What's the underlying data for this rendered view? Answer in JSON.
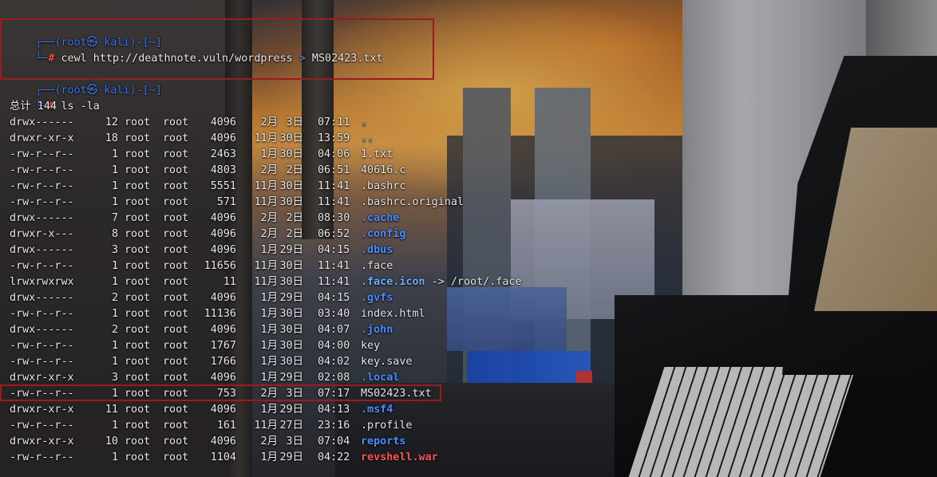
{
  "theme": {
    "prompt_color": "#3f74e8",
    "root_color": "#ff4a4a",
    "dir_color": "#4a8cff",
    "highlight_border": "#9b1b22"
  },
  "session": {
    "prompt1_top": "┌──(root㉿ kali)-[~]",
    "prompt1_mark": "└─",
    "prompt1_hash": "#",
    "cmd1": "cewl http://deathnote.vuln/wordpress",
    "cmd1_redirect": " > ",
    "cmd1_target": "MS02423.txt",
    "prompt2_top": "┌──(root㉿ kali)-[~]",
    "prompt2_mark": "└─",
    "prompt2_hash": "#",
    "cmd2": "ls -la",
    "total": "总计 144"
  },
  "listing": [
    {
      "perm": "drwx------",
      "links": "12",
      "user": "root",
      "group": "root",
      "size": "4096",
      "mon": "2月",
      "day": "3日",
      "time": "07:11",
      "name": ".",
      "kind": "dir"
    },
    {
      "perm": "drwxr-xr-x",
      "links": "18",
      "user": "root",
      "group": "root",
      "size": "4096",
      "mon": "11月",
      "day": "30日",
      "time": "13:59",
      "name": "..",
      "kind": "dir"
    },
    {
      "perm": "-rw-r--r--",
      "links": "1",
      "user": "root",
      "group": "root",
      "size": "2463",
      "mon": "1月",
      "day": "30日",
      "time": "04:06",
      "name": "1.txt",
      "kind": "plain"
    },
    {
      "perm": "-rw-r--r--",
      "links": "1",
      "user": "root",
      "group": "root",
      "size": "4803",
      "mon": "2月",
      "day": "2日",
      "time": "06:51",
      "name": "40616.c",
      "kind": "plain"
    },
    {
      "perm": "-rw-r--r--",
      "links": "1",
      "user": "root",
      "group": "root",
      "size": "5551",
      "mon": "11月",
      "day": "30日",
      "time": "11:41",
      "name": ".bashrc",
      "kind": "plain"
    },
    {
      "perm": "-rw-r--r--",
      "links": "1",
      "user": "root",
      "group": "root",
      "size": "571",
      "mon": "11月",
      "day": "30日",
      "time": "11:41",
      "name": ".bashrc.original",
      "kind": "plain"
    },
    {
      "perm": "drwx------",
      "links": "7",
      "user": "root",
      "group": "root",
      "size": "4096",
      "mon": "2月",
      "day": "2日",
      "time": "08:30",
      "name": ".cache",
      "kind": "dir"
    },
    {
      "perm": "drwxr-x---",
      "links": "8",
      "user": "root",
      "group": "root",
      "size": "4096",
      "mon": "2月",
      "day": "2日",
      "time": "06:52",
      "name": ".config",
      "kind": "dir"
    },
    {
      "perm": "drwx------",
      "links": "3",
      "user": "root",
      "group": "root",
      "size": "4096",
      "mon": "1月",
      "day": "29日",
      "time": "04:15",
      "name": ".dbus",
      "kind": "dir"
    },
    {
      "perm": "-rw-r--r--",
      "links": "1",
      "user": "root",
      "group": "root",
      "size": "11656",
      "mon": "11月",
      "day": "30日",
      "time": "11:41",
      "name": ".face",
      "kind": "plain"
    },
    {
      "perm": "lrwxrwxrwx",
      "links": "1",
      "user": "root",
      "group": "root",
      "size": "11",
      "mon": "11月",
      "day": "30日",
      "time": "11:41",
      "name": ".face.icon",
      "link_arrow": " -> ",
      "link_target": "/root/.face",
      "kind": "link"
    },
    {
      "perm": "drwx------",
      "links": "2",
      "user": "root",
      "group": "root",
      "size": "4096",
      "mon": "1月",
      "day": "29日",
      "time": "04:15",
      "name": ".gvfs",
      "kind": "dir"
    },
    {
      "perm": "-rw-r--r--",
      "links": "1",
      "user": "root",
      "group": "root",
      "size": "11136",
      "mon": "1月",
      "day": "30日",
      "time": "03:40",
      "name": "index.html",
      "kind": "plain"
    },
    {
      "perm": "drwx------",
      "links": "2",
      "user": "root",
      "group": "root",
      "size": "4096",
      "mon": "1月",
      "day": "30日",
      "time": "04:07",
      "name": ".john",
      "kind": "dir"
    },
    {
      "perm": "-rw-r--r--",
      "links": "1",
      "user": "root",
      "group": "root",
      "size": "1767",
      "mon": "1月",
      "day": "30日",
      "time": "04:00",
      "name": "key",
      "kind": "plain"
    },
    {
      "perm": "-rw-r--r--",
      "links": "1",
      "user": "root",
      "group": "root",
      "size": "1766",
      "mon": "1月",
      "day": "30日",
      "time": "04:02",
      "name": "key.save",
      "kind": "plain"
    },
    {
      "perm": "drwxr-xr-x",
      "links": "3",
      "user": "root",
      "group": "root",
      "size": "4096",
      "mon": "1月",
      "day": "29日",
      "time": "02:08",
      "name": ".local",
      "kind": "dir"
    },
    {
      "perm": "-rw-r--r--",
      "links": "1",
      "user": "root",
      "group": "root",
      "size": "753",
      "mon": "2月",
      "day": "3日",
      "time": "07:17",
      "name": "MS02423.txt",
      "kind": "plain"
    },
    {
      "perm": "drwxr-xr-x",
      "links": "11",
      "user": "root",
      "group": "root",
      "size": "4096",
      "mon": "1月",
      "day": "29日",
      "time": "04:13",
      "name": ".msf4",
      "kind": "dir"
    },
    {
      "perm": "-rw-r--r--",
      "links": "1",
      "user": "root",
      "group": "root",
      "size": "161",
      "mon": "11月",
      "day": "27日",
      "time": "23:16",
      "name": ".profile",
      "kind": "plain"
    },
    {
      "perm": "drwxr-xr-x",
      "links": "10",
      "user": "root",
      "group": "root",
      "size": "4096",
      "mon": "2月",
      "day": "3日",
      "time": "07:04",
      "name": "reports",
      "kind": "dir"
    },
    {
      "perm": "-rw-r--r--",
      "links": "1",
      "user": "root",
      "group": "root",
      "size": "1104",
      "mon": "1月",
      "day": "29日",
      "time": "04:22",
      "name": "revshell.war",
      "kind": "exec-red"
    }
  ]
}
